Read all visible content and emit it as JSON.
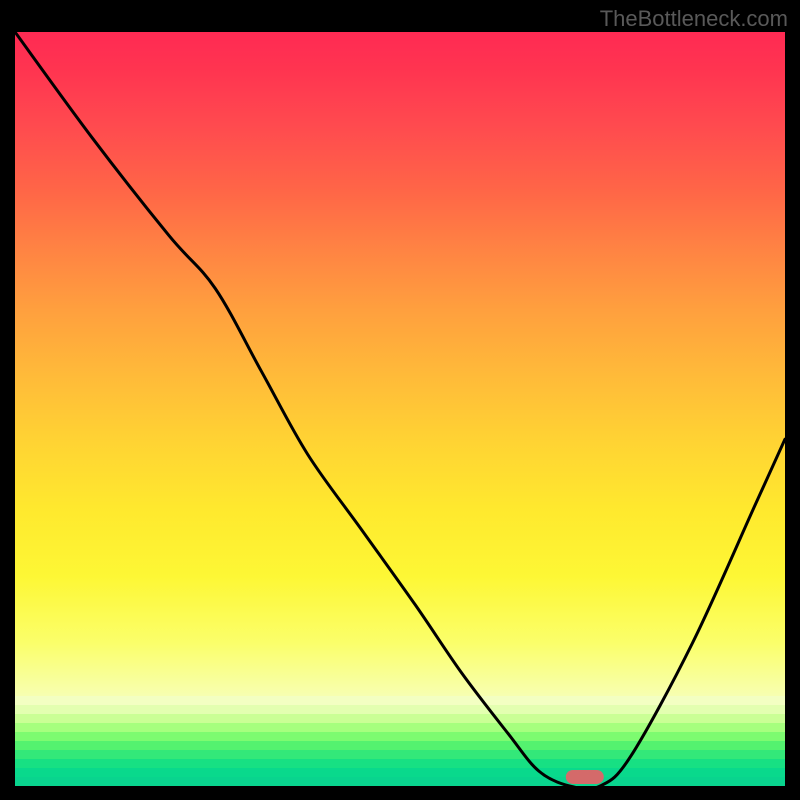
{
  "watermark": "TheBottleneck.com",
  "chart_data": {
    "type": "line",
    "title": "",
    "xlabel": "",
    "ylabel": "",
    "xlim": [
      0,
      100
    ],
    "ylim": [
      0,
      100
    ],
    "series": [
      {
        "name": "curve",
        "x": [
          0,
          10,
          20,
          26,
          32,
          38,
          45,
          52,
          58,
          64,
          68,
          72,
          76,
          80,
          88,
          96,
          100
        ],
        "values": [
          100,
          86,
          73,
          66,
          55,
          44,
          34,
          24,
          15,
          7,
          2,
          0,
          0,
          4,
          19,
          37,
          46
        ]
      }
    ],
    "marker": {
      "x": 74,
      "y": 1.2
    },
    "gradient_bands": [
      "#f3ffc2",
      "#e3ffb0",
      "#caff95",
      "#a6ff7e",
      "#7dfb70",
      "#54f26f",
      "#33e879",
      "#17e083",
      "#09d98c",
      "#09d48e"
    ]
  }
}
